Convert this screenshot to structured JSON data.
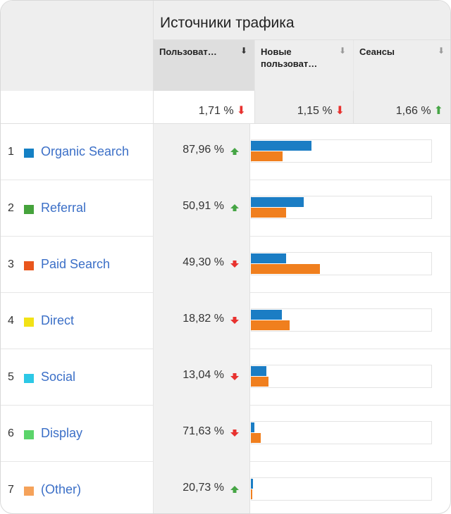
{
  "header": {
    "title": "Источники трафика",
    "columns": [
      {
        "label": "Пользоват…",
        "sort_icon": "arrow-down-icon",
        "selected": true
      },
      {
        "label": "Новые пользоват…",
        "sort_icon": "arrow-down-icon",
        "selected": false
      },
      {
        "label": "Сеансы",
        "sort_icon": "arrow-down-icon",
        "selected": false
      }
    ]
  },
  "totals": [
    {
      "value": "1,71 %",
      "trend": "down"
    },
    {
      "value": "1,15 %",
      "trend": "down"
    },
    {
      "value": "1,66 %",
      "trend": "up"
    }
  ],
  "colors": {
    "series_1": "#1b7dc4",
    "series_2": "#f07f1e",
    "up": "#46a545",
    "down": "#e8322f",
    "link": "#3b6fc7"
  },
  "rows": [
    {
      "rank": "1",
      "name": "Organic Search",
      "color": "#1480c4",
      "pct": "87,96 %",
      "trend": "up",
      "bar1": 0.335,
      "bar2": 0.176
    },
    {
      "rank": "2",
      "name": "Referral",
      "color": "#46a33c",
      "pct": "50,91 %",
      "trend": "up",
      "bar1": 0.292,
      "bar2": 0.195
    },
    {
      "rank": "3",
      "name": "Paid Search",
      "color": "#e9561d",
      "pct": "49,30 %",
      "trend": "down",
      "bar1": 0.195,
      "bar2": 0.381
    },
    {
      "rank": "4",
      "name": "Direct",
      "color": "#f2e216",
      "pct": "18,82 %",
      "trend": "down",
      "bar1": 0.171,
      "bar2": 0.214
    },
    {
      "rank": "5",
      "name": "Social",
      "color": "#2dc8e6",
      "pct": "13,04 %",
      "trend": "down",
      "bar1": 0.086,
      "bar2": 0.097
    },
    {
      "rank": "6",
      "name": "Display",
      "color": "#5bd46a",
      "pct": "71,63 %",
      "trend": "down",
      "bar1": 0.018,
      "bar2": 0.054
    },
    {
      "rank": "7",
      "name": "(Other)",
      "color": "#f5a25a",
      "pct": "20,73 %",
      "trend": "up",
      "bar1": 0.012,
      "bar2": 0.008
    }
  ]
}
